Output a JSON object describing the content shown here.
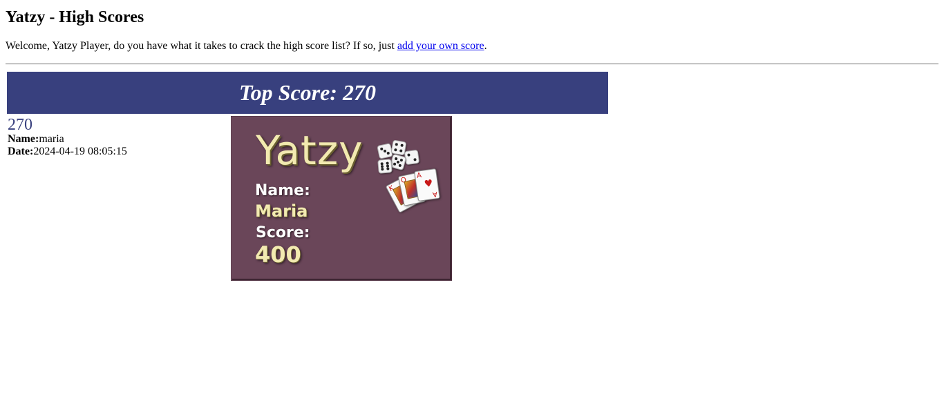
{
  "page": {
    "title": "Yatzy - High Scores",
    "intro_text": "Welcome, Yatzy Player, do you have what it takes to crack the high score list? If so, just ",
    "intro_link": "add your own score",
    "intro_end": "."
  },
  "banner": {
    "text": "Top Score: 270"
  },
  "entry": {
    "score": "270",
    "name_label": "Name:",
    "name": "maria",
    "date_label": "Date:",
    "date": "2024-04-19 08:05:15"
  },
  "score_card": {
    "title": "Yatzy",
    "name_label": "Name:",
    "name": "Maria",
    "score_label": "Score:",
    "score": "400"
  },
  "colors": {
    "banner_bg": "#38407e",
    "score_text": "#38407e",
    "card_bg": "#6a4659",
    "card_accent": "#f2eab0",
    "link": "#0000ee"
  },
  "icons": [
    "dice-icon",
    "playing-cards-icon"
  ]
}
